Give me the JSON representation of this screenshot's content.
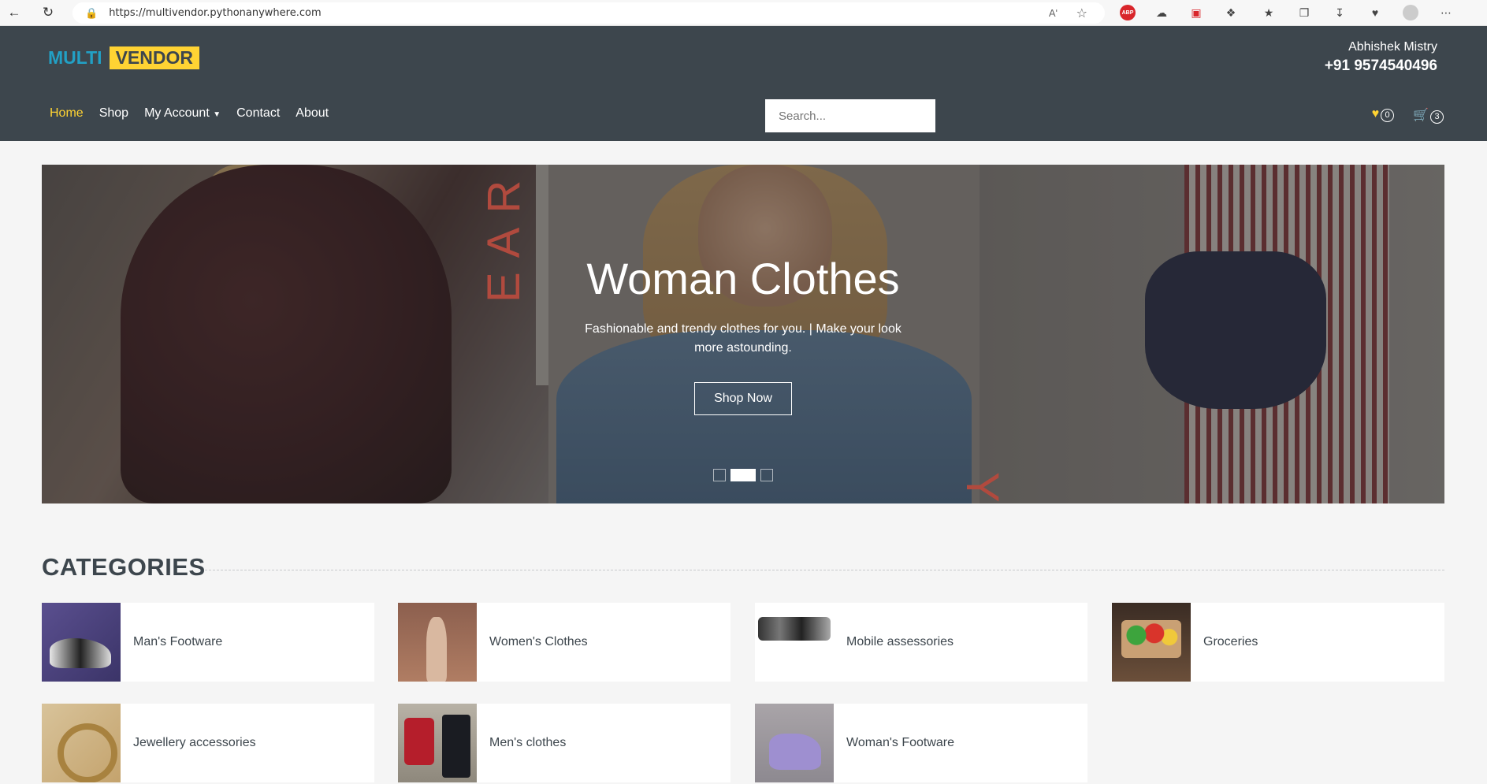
{
  "browser": {
    "url": "https://multivendor.pythonanywhere.com",
    "read_aloud": "Aʹ"
  },
  "header": {
    "logo_part1": "MULTI",
    "logo_part2": "VENDOR",
    "contact_name": "Abhishek Mistry",
    "contact_phone": "+91 9574540496",
    "nav": {
      "home": "Home",
      "shop": "Shop",
      "my_account": "My Account",
      "contact": "Contact",
      "about": "About"
    },
    "search_placeholder": "Search...",
    "wishlist_count": "0",
    "cart_count": "3",
    "accent_color": "#ffd333",
    "header_bg": "#3d464d"
  },
  "carousel": {
    "title": "Woman Clothes",
    "subtitle": "Fashionable and trendy clothes for you. | Make your look more astounding.",
    "button": "Shop Now",
    "letters_left": "EARN",
    "letters_right": "YOUR",
    "slide_count": 3,
    "active_slide": 2
  },
  "categories": {
    "heading": "CATEGORIES",
    "items": [
      {
        "label": "Man's Footware"
      },
      {
        "label": "Women's Clothes"
      },
      {
        "label": "Mobile assessories"
      },
      {
        "label": "Groceries"
      },
      {
        "label": "Jewellery accessories"
      },
      {
        "label": "Men's clothes"
      },
      {
        "label": "Woman's Footware"
      }
    ]
  }
}
